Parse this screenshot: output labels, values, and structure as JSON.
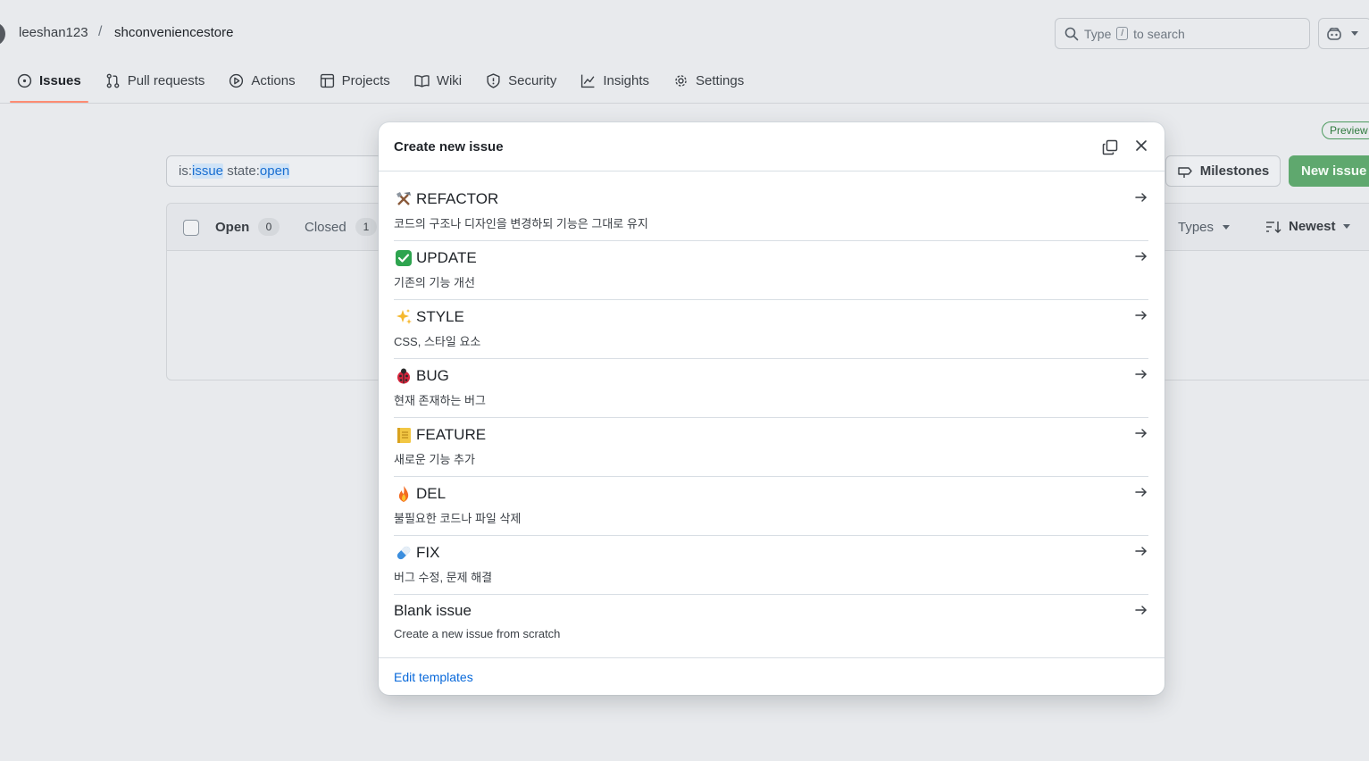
{
  "header": {
    "owner": "leeshan123",
    "separator": "/",
    "repo": "shconveniencestore",
    "search": {
      "prefix": "Type",
      "key": "/",
      "suffix": "to search"
    }
  },
  "tabs": [
    {
      "label": "Issues",
      "icon": "issue-opened-icon",
      "selected": true
    },
    {
      "label": "Pull requests",
      "icon": "git-pull-request-icon"
    },
    {
      "label": "Actions",
      "icon": "play-icon"
    },
    {
      "label": "Projects",
      "icon": "table-icon"
    },
    {
      "label": "Wiki",
      "icon": "book-icon"
    },
    {
      "label": "Security",
      "icon": "shield-icon"
    },
    {
      "label": "Insights",
      "icon": "graph-icon"
    },
    {
      "label": "Settings",
      "icon": "gear-icon"
    }
  ],
  "page": {
    "preview_badge": "Preview",
    "filter": {
      "is_key": "is:",
      "is_val": "issue",
      "state_key": " state:",
      "state_val": "open"
    },
    "milestones_label": "Milestones",
    "new_issue_label": "New issue",
    "open_label": "Open",
    "open_count": "0",
    "closed_label": "Closed",
    "closed_count": "1",
    "types_label": "Types",
    "sort_label": "Newest"
  },
  "dialog": {
    "title": "Create new issue",
    "templates": [
      {
        "emoji": "hammer-and-pick",
        "title": "REFACTOR",
        "desc": "코드의 구조나 디자인을 변경하되 기능은 그대로 유지"
      },
      {
        "emoji": "check-mark-button",
        "title": "UPDATE",
        "desc": "기존의 기능 개선"
      },
      {
        "emoji": "sparkles",
        "title": "STYLE",
        "desc": "CSS, 스타일 요소"
      },
      {
        "emoji": "lady-beetle",
        "title": "BUG",
        "desc": "현재 존재하는 버그"
      },
      {
        "emoji": "ledger",
        "title": "FEATURE",
        "desc": "새로운 기능 추가"
      },
      {
        "emoji": "fire",
        "title": "DEL",
        "desc": "불필요한 코드나 파일 삭제"
      },
      {
        "emoji": "pill",
        "title": "FIX",
        "desc": "버그 수정, 문제 해결"
      },
      {
        "emoji": "",
        "title": "Blank issue",
        "desc": "Create a new issue from scratch"
      }
    ],
    "edit_templates_label": "Edit templates"
  },
  "colors": {
    "accent": "#0969da",
    "primary_button": "#5fa86e",
    "tab_underline": "#fd8c73"
  }
}
